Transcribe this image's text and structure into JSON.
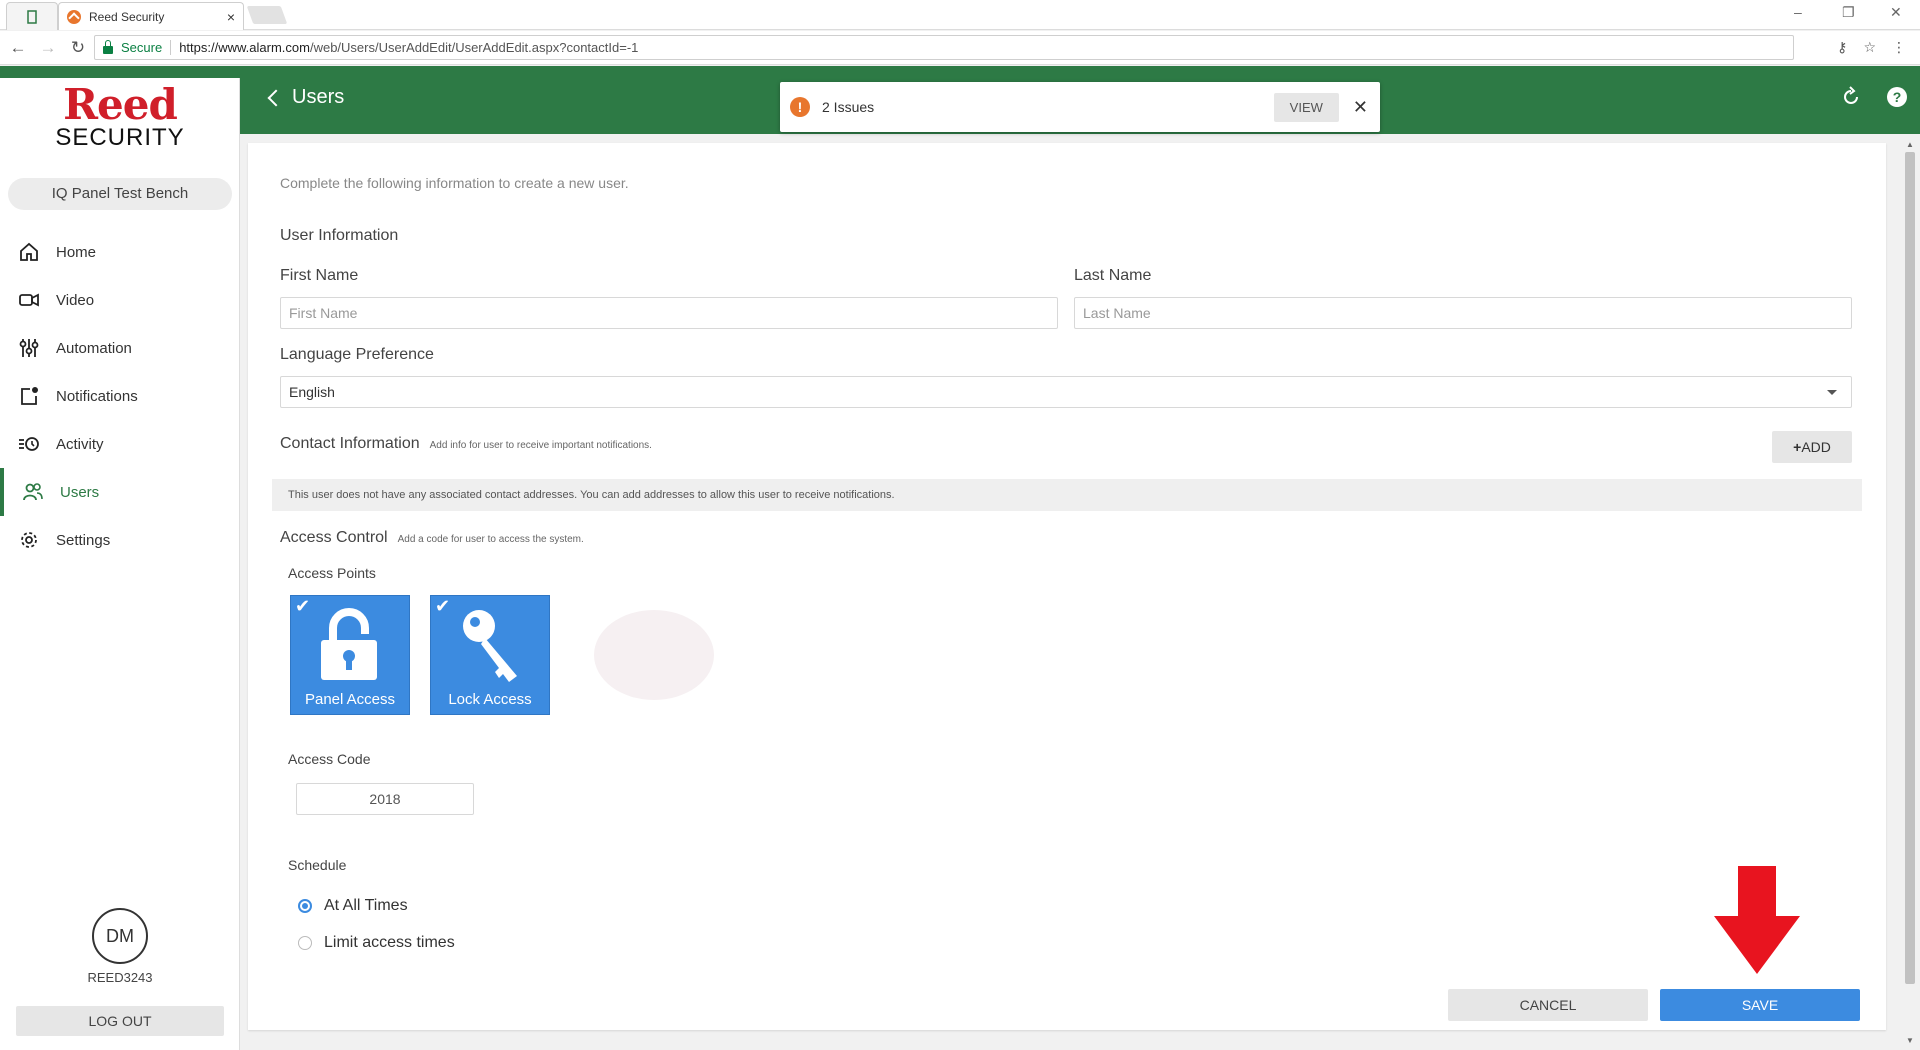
{
  "browser": {
    "tab_title": "Reed Security",
    "tab_close": "×",
    "secure_label": "Secure",
    "url_host": "https://www.alarm.com",
    "url_rest": "/web/Users/UserAddEdit/UserAddEdit.aspx?contactId=-1",
    "window_controls": [
      "–",
      "❐",
      "✕"
    ]
  },
  "logo": {
    "brand": "Reed",
    "sub": "SECURITY"
  },
  "sidebar": {
    "system_name": "IQ Panel Test Bench",
    "items": [
      {
        "label": "Home",
        "icon": "home-icon"
      },
      {
        "label": "Video",
        "icon": "video-icon"
      },
      {
        "label": "Automation",
        "icon": "automation-icon"
      },
      {
        "label": "Notifications",
        "icon": "notifications-icon"
      },
      {
        "label": "Activity",
        "icon": "activity-icon"
      },
      {
        "label": "Users",
        "icon": "users-icon",
        "active": true
      },
      {
        "label": "Settings",
        "icon": "settings-icon"
      }
    ],
    "avatar_initials": "DM",
    "username": "REED3243",
    "logout_label": "LOG OUT"
  },
  "header": {
    "back_label": "Users",
    "issues": {
      "icon": "!",
      "text": "2 Issues",
      "view_label": "VIEW",
      "close": "✕"
    }
  },
  "form": {
    "intro": "Complete the following information to create a new user.",
    "user_info_title": "User Information",
    "first_name_label": "First Name",
    "first_name_placeholder": "First Name",
    "last_name_label": "Last Name",
    "last_name_placeholder": "Last Name",
    "language_label": "Language Preference",
    "language_value": "English",
    "contact_title": "Contact Information",
    "contact_hint": "Add info for user to receive important notifications.",
    "add_label": "ADD",
    "contact_notice": "This user does not have any associated contact addresses. You can add addresses to allow this user to receive notifications.",
    "access_title": "Access Control",
    "access_hint": "Add a code for user to access the system.",
    "access_points_label": "Access Points",
    "access_points": [
      {
        "label": "Panel Access",
        "checked": true,
        "icon": "unlock-icon"
      },
      {
        "label": "Lock Access",
        "checked": true,
        "icon": "key-icon"
      }
    ],
    "access_code_label": "Access Code",
    "access_code_value": "2018",
    "schedule_label": "Schedule",
    "schedule_options": [
      {
        "label": "At All Times",
        "selected": true
      },
      {
        "label": "Limit access times",
        "selected": false
      }
    ],
    "cancel_label": "CANCEL",
    "save_label": "SAVE"
  },
  "colors": {
    "brand_green": "#2d7a45",
    "primary_blue": "#3c8be0",
    "warning_orange": "#e8762d",
    "logo_red": "#d01f2a",
    "arrow_red": "#e8141f"
  }
}
